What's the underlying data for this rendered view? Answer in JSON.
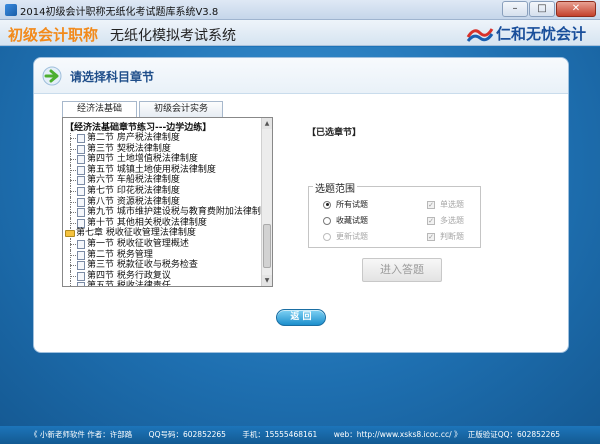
{
  "window": {
    "title": "2014初级会计职称无纸化考试题库系统V3.8",
    "buttons": {
      "minimize": "–",
      "maximize": "□",
      "close": "✕"
    }
  },
  "header": {
    "category": "初级会计职称",
    "system_name": "无纸化模拟考试系统",
    "brand": "仁和无忧会计"
  },
  "panel": {
    "title": "请选择科目章节",
    "tabs": [
      {
        "label": "经济法基础",
        "active": true
      },
      {
        "label": "初级会计实务",
        "active": false
      }
    ],
    "tree": {
      "heading": "【经济法基础章节练习---边学边练】",
      "items": [
        {
          "label": "第二节  房产税法律制度",
          "type": "doc",
          "level": 2
        },
        {
          "label": "第三节  契税法律制度",
          "type": "doc",
          "level": 2
        },
        {
          "label": "第四节  土地增值税法律制度",
          "type": "doc",
          "level": 2
        },
        {
          "label": "第五节  城镇土地使用税法律制度",
          "type": "doc",
          "level": 2
        },
        {
          "label": "第六节  车船税法律制度",
          "type": "doc",
          "level": 2
        },
        {
          "label": "第七节  印花税法律制度",
          "type": "doc",
          "level": 2
        },
        {
          "label": "第八节  资源税法律制度",
          "type": "doc",
          "level": 2
        },
        {
          "label": "第九节  城市维护建设税与教育费附加法律制度",
          "type": "doc",
          "level": 2
        },
        {
          "label": "第十节  其他相关税收法律制度",
          "type": "doc",
          "level": 2
        },
        {
          "label": "第七章  税收征收管理法律制度",
          "type": "folder",
          "level": 1
        },
        {
          "label": "第一节  税收征收管理概述",
          "type": "doc",
          "level": 2
        },
        {
          "label": "第二节  税务管理",
          "type": "doc",
          "level": 2
        },
        {
          "label": "第三节  税款征收与税务检查",
          "type": "doc",
          "level": 2
        },
        {
          "label": "第四节  税务行政复议",
          "type": "doc",
          "level": 2
        },
        {
          "label": "第五节  税收法律责任",
          "type": "doc",
          "level": 2
        }
      ]
    },
    "selected_heading": "【已选章节】",
    "scope": {
      "title": "选题范围",
      "radios": [
        {
          "label": "所有试题",
          "checked": true,
          "disabled": false
        },
        {
          "label": "收藏试题",
          "checked": false,
          "disabled": false
        },
        {
          "label": "更新试题",
          "checked": false,
          "disabled": true
        }
      ],
      "checkboxes": [
        {
          "label": "单选题",
          "checked": true,
          "disabled": true
        },
        {
          "label": "多选题",
          "checked": true,
          "disabled": true
        },
        {
          "label": "判断题",
          "checked": true,
          "disabled": true
        }
      ]
    },
    "enter_button": "进入答题",
    "back_button": "返  回"
  },
  "footer": {
    "author": "《 小新老师软件   作者：许部路",
    "qq": "QQ号码：602852265",
    "phone": "手机：15555468161",
    "web": "web：http://www.xsks8.icoc.cc/  》",
    "verify": "正版验证QQ：602852265"
  }
}
